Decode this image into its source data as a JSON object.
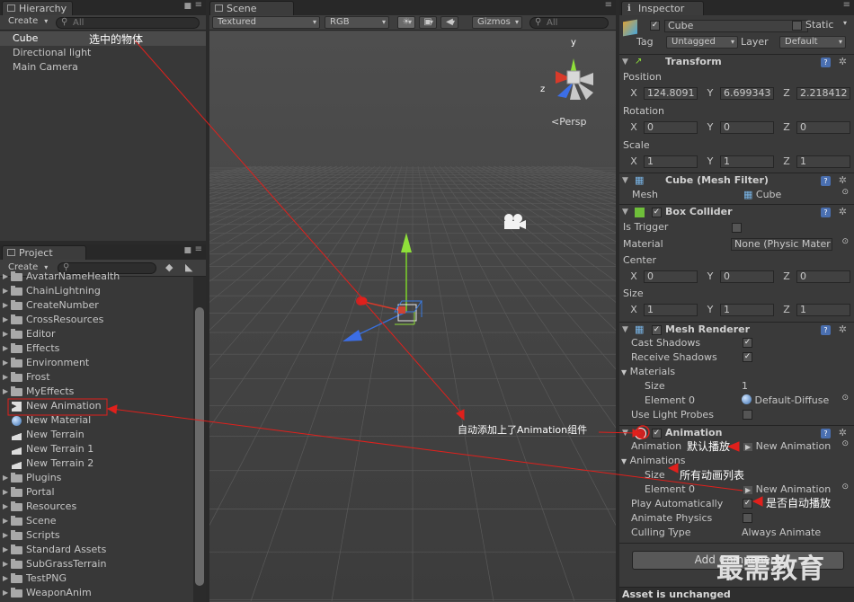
{
  "hierarchy": {
    "tab": "Hierarchy",
    "create": "Create",
    "search": "All",
    "items": [
      "Cube",
      "Directional light",
      "Main Camera"
    ]
  },
  "project": {
    "tab": "Project",
    "create": "Create",
    "items": [
      "AvatarNameHealth",
      "ChainLightning",
      "CreateNumber",
      "CrossResources",
      "Editor",
      "Effects",
      "Environment",
      "Frost",
      "MyEffects",
      "New Animation",
      "New Material",
      "New Terrain",
      "New Terrain 1",
      "New Terrain 2",
      "Plugins",
      "Portal",
      "Resources",
      "Scene",
      "Scripts",
      "Standard Assets",
      "SubGrassTerrain",
      "TestPNG",
      "WeaponAnim"
    ]
  },
  "scene": {
    "tab": "Scene",
    "mode": "Textured",
    "channel": "RGB",
    "gizmos": "Gizmos",
    "search": "All",
    "persp": "Persp",
    "axis_y": "y",
    "axis_z": "z"
  },
  "inspector": {
    "tab": "Inspector",
    "object_name": "Cube",
    "static": "Static",
    "tag_label": "Tag",
    "tag": "Untagged",
    "layer_label": "Layer",
    "layer": "Default",
    "transform": {
      "title": "Transform",
      "position": "Position",
      "rotation": "Rotation",
      "scale": "Scale",
      "x": "X",
      "y": "Y",
      "z": "Z",
      "pos": [
        "124.8091",
        "6.699343",
        "2.218412"
      ],
      "rot": [
        "0",
        "0",
        "0"
      ],
      "scl": [
        "1",
        "1",
        "1"
      ]
    },
    "mesh_filter": {
      "title": "Cube (Mesh Filter)",
      "mesh_label": "Mesh",
      "mesh": "Cube"
    },
    "box_collider": {
      "title": "Box Collider",
      "is_trigger": "Is Trigger",
      "material": "Material",
      "material_value": "None (Physic Mater",
      "center": "Center",
      "size": "Size",
      "center_v": [
        "0",
        "0",
        "0"
      ],
      "size_v": [
        "1",
        "1",
        "1"
      ]
    },
    "mesh_renderer": {
      "title": "Mesh Renderer",
      "cast": "Cast Shadows",
      "receive": "Receive Shadows",
      "materials": "Materials",
      "size": "Size",
      "size_v": "1",
      "element0": "Element 0",
      "element0_v": "Default-Diffuse",
      "light_probes": "Use Light Probes"
    },
    "animation": {
      "title": "Animation",
      "animation_label": "Animation",
      "animation_v": "New Animation",
      "animations": "Animations",
      "size": "Size",
      "element0": "Element 0",
      "element0_v": "New Animation",
      "play_auto": "Play Automatically",
      "animate_physics": "Animate Physics",
      "culling": "Culling Type",
      "culling_v": "Always Animate"
    },
    "add_component": "Add Component",
    "status": "Asset is unchanged"
  },
  "annotations": {
    "selected": "选中的物体",
    "auto_added": "自动添加上了Animation组件",
    "default_play": "默认播放",
    "all_list": "所有动画列表",
    "is_auto": "是否自动播放",
    "watermark": "最需教育"
  },
  "colors": {
    "accent_red": "#e0201c",
    "selection": "#4a4a4a"
  }
}
